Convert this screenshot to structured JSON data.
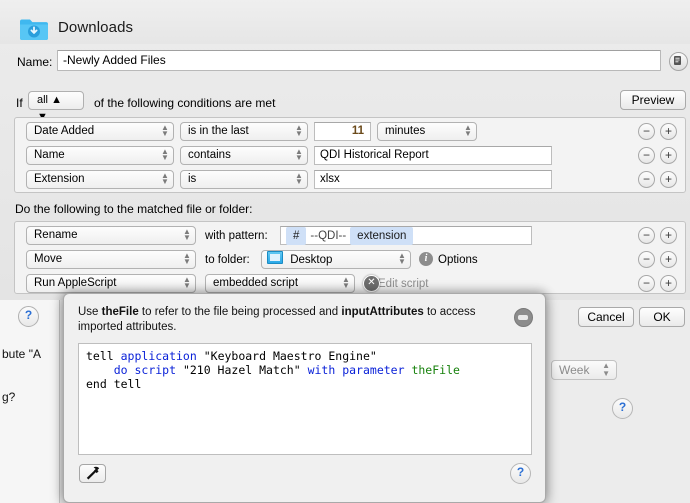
{
  "window": {
    "title": "Downloads",
    "folder_icon": "downloads-folder-icon"
  },
  "name_row": {
    "label": "Name:",
    "value": "-Newly Added Files",
    "note_icon": "note-document-icon"
  },
  "match_row": {
    "if_label": "If",
    "match_value": "all",
    "suffix": "of the following conditions are met",
    "preview_label": "Preview"
  },
  "conditions": [
    {
      "attribute": "Date Added",
      "operator": "is in the last",
      "value": "11",
      "unit": "minutes",
      "remove_label": "−",
      "add_label": "+"
    },
    {
      "attribute": "Name",
      "operator": "contains",
      "value": "QDI Historical Report",
      "remove_label": "−",
      "add_label": "+"
    },
    {
      "attribute": "Extension",
      "operator": "is",
      "value": "xlsx",
      "remove_label": "−",
      "add_label": "+"
    }
  ],
  "actions_label": "Do the following to the matched file or folder:",
  "actions": [
    {
      "action": "Rename",
      "secondary_label": "with pattern:",
      "tokens": [
        {
          "text": "#",
          "type": "token"
        },
        {
          "text": "--QDI--",
          "type": "plain"
        },
        {
          "text": "extension",
          "type": "token"
        }
      ],
      "remove_label": "−",
      "add_label": "+"
    },
    {
      "action": "Move",
      "secondary_label": "to folder:",
      "folder": "Desktop",
      "folder_icon": "folder-icon",
      "options_label": "Options",
      "info_icon": "info-icon",
      "remove_label": "−",
      "add_label": "+"
    },
    {
      "action": "Run AppleScript",
      "script_source": "embedded script",
      "edit_label": "Edit script",
      "close_badge": "✕",
      "remove_label": "−",
      "add_label": "+"
    }
  ],
  "script_sheet": {
    "hint_prefix": "Use ",
    "hint_bold1": "theFile",
    "hint_mid": " to refer to the file being processed and ",
    "hint_bold2": "inputAttributes",
    "hint_suffix": " to access imported attributes.",
    "collapse_icon": "collapse-button-icon",
    "hammer_icon": "hammer-icon",
    "help_icon": "?",
    "code_lines": [
      {
        "segments": [
          {
            "text": "tell ",
            "style": "plain"
          },
          {
            "text": "application",
            "style": "keyword"
          },
          {
            "text": " \"Keyboard Maestro Engine\"",
            "style": "plain"
          }
        ]
      },
      {
        "segments": [
          {
            "text": "    ",
            "style": "plain"
          },
          {
            "text": "do script",
            "style": "keyword"
          },
          {
            "text": " \"210 Hazel Match\" ",
            "style": "plain"
          },
          {
            "text": "with parameter",
            "style": "keyword"
          },
          {
            "text": " ",
            "style": "plain"
          },
          {
            "text": "theFile",
            "style": "variable"
          }
        ]
      },
      {
        "segments": [
          {
            "text": "end tell",
            "style": "plain"
          }
        ]
      }
    ]
  },
  "dialog_buttons": {
    "cancel": "Cancel",
    "ok": "OK"
  },
  "background": {
    "help_icon_top": "?",
    "truncated_text_1": "bute \"A",
    "truncated_text_2": "g?",
    "week_select": "Week",
    "help_icon_bottom": "?"
  },
  "colors": {
    "token_blue": "#cfe0f7",
    "keyword_blue": "#0b22d8",
    "variable_green": "#18820d",
    "folder_blue": "#2aa8e8",
    "help_blue": "#2b6fd4",
    "sheet_gray": "#ececec"
  }
}
